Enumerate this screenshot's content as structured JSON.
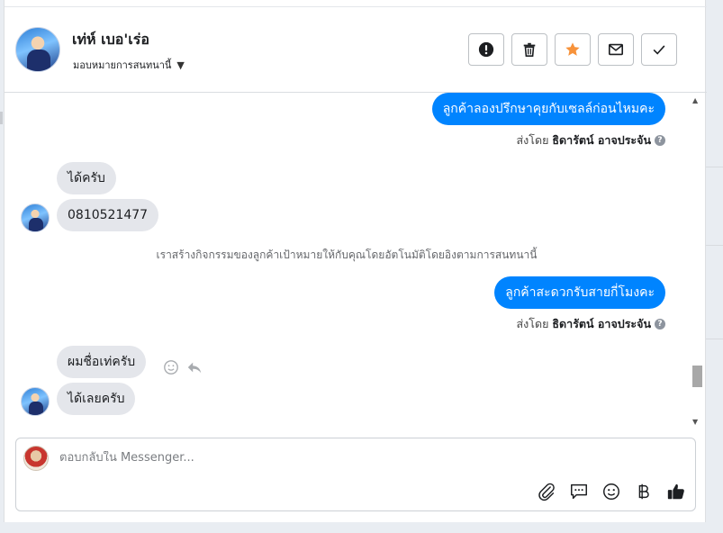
{
  "header": {
    "contact_name": "เท่ห์ เบอ'เร่อ",
    "assign_label": "มอบหมายการสนทนานี้",
    "actions": [
      {
        "name": "mark-spam-button",
        "icon": "exclamation-icon"
      },
      {
        "name": "delete-button",
        "icon": "trash-icon"
      },
      {
        "name": "star-button",
        "icon": "star-icon",
        "color": "#f7923a"
      },
      {
        "name": "mark-unread-button",
        "icon": "envelope-icon"
      },
      {
        "name": "mark-done-button",
        "icon": "check-icon"
      }
    ]
  },
  "messages": {
    "out_1": "ลูกค้าลองปรึกษาคุยกับเซลล์ก่อนไหมคะ",
    "sent_by_prefix": "ส่งโดย",
    "sent_by_name": "ธิดารัตน์ อาจประจัน",
    "in_1": "ได้ครับ",
    "in_2": "0810521477",
    "system_note": "เราสร้างกิจกรรมของลูกค้าเป้าหมายให้กับคุณโดยอัตโนมัติโดยอิงตามการสนทนานี้",
    "out_2": "ลูกค้าสะดวกรับสายกี่โมงคะ",
    "in_3": "ผมชื่อเท่ครับ",
    "in_4": "ได้เลยครับ"
  },
  "composer": {
    "placeholder": "ตอบกลับใน Messenger..."
  },
  "colors": {
    "outgoing_bubble": "#0084ff",
    "incoming_bubble": "#e4e6eb",
    "star": "#f7923a"
  }
}
